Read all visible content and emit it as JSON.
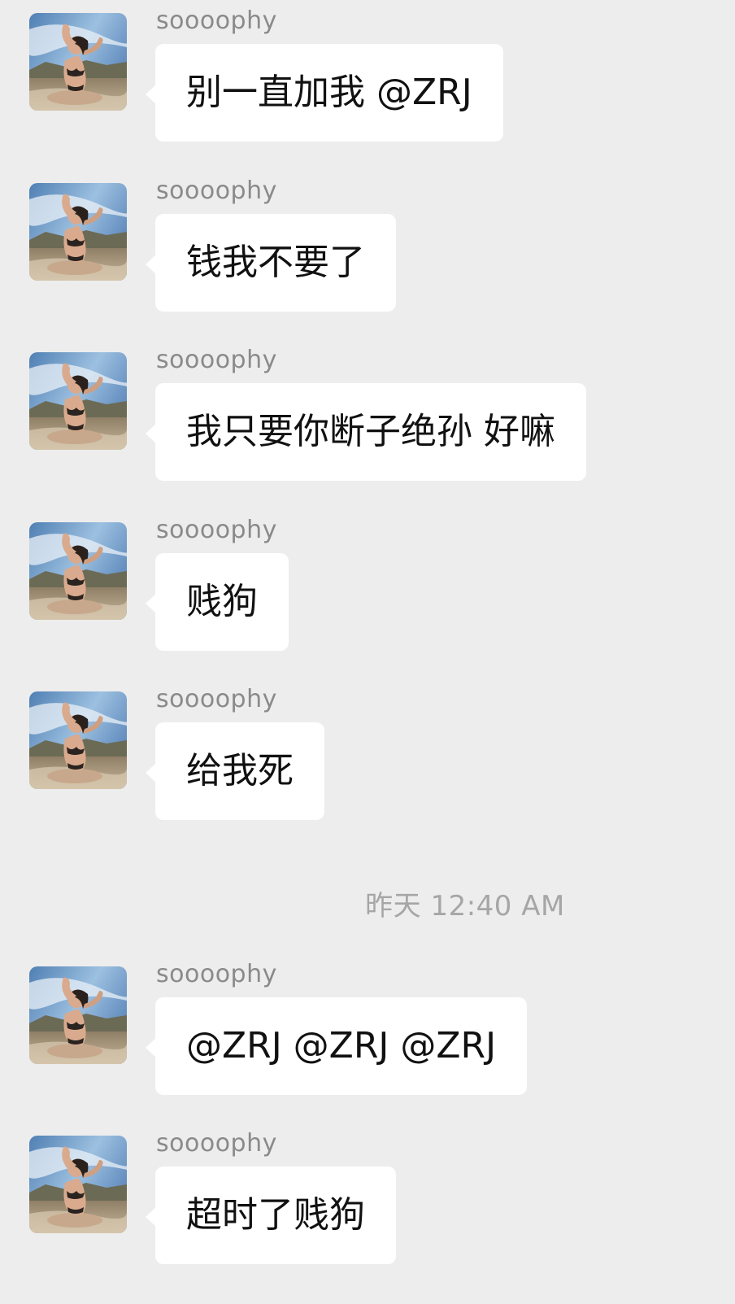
{
  "chat": {
    "timestamp": "昨天 12:40 AM",
    "messages": [
      {
        "sender": "soooophy",
        "text": "别一直加我 @ZRJ"
      },
      {
        "sender": "soooophy",
        "text": "钱我不要了"
      },
      {
        "sender": "soooophy",
        "text": "我只要你断子绝孙 好嘛"
      },
      {
        "sender": "soooophy",
        "text": "贱狗"
      },
      {
        "sender": "soooophy",
        "text": "给我死"
      },
      {
        "sender": "soooophy",
        "text": "@ZRJ @ZRJ @ZRJ"
      },
      {
        "sender": "soooophy",
        "text": "超时了贱狗"
      }
    ]
  },
  "colors": {
    "background": "#ededed",
    "bubble": "#ffffff",
    "sender_text": "#8a8a8a",
    "timestamp_text": "#a6a6a6"
  },
  "icons": {
    "avatar": "avatar-photo-icon"
  }
}
